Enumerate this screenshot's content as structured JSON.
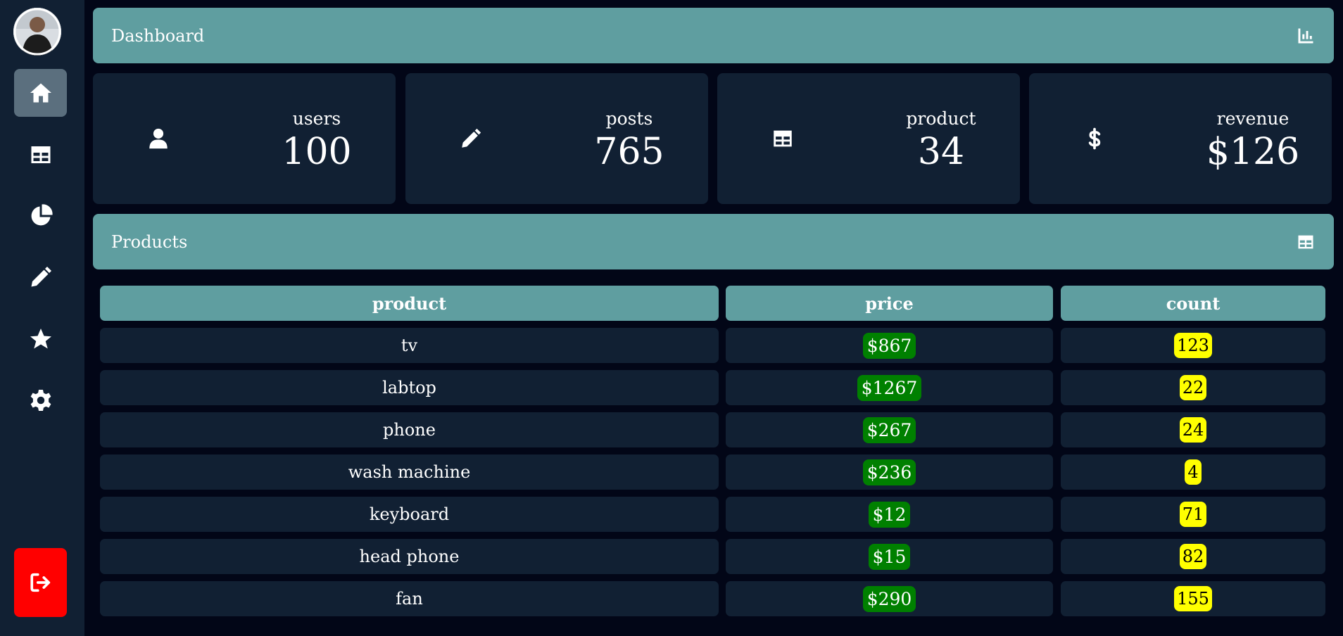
{
  "header": {
    "title": "Dashboard",
    "icon": "chart-bar-icon"
  },
  "sidebar": {
    "items": [
      {
        "name": "home",
        "icon": "home-icon",
        "active": true
      },
      {
        "name": "table",
        "icon": "table-icon",
        "active": false
      },
      {
        "name": "chart",
        "icon": "pie-chart-icon",
        "active": false
      },
      {
        "name": "edit",
        "icon": "pencil-icon",
        "active": false
      },
      {
        "name": "favorites",
        "icon": "star-icon",
        "active": false
      },
      {
        "name": "settings",
        "icon": "gear-icon",
        "active": false
      }
    ],
    "logout_icon": "logout-icon"
  },
  "stats": [
    {
      "label": "users",
      "value": "100",
      "icon": "user-icon"
    },
    {
      "label": "posts",
      "value": "765",
      "icon": "pencil-icon"
    },
    {
      "label": "product",
      "value": "34",
      "icon": "table-icon"
    },
    {
      "label": "revenue",
      "value": "$126",
      "icon": "dollar-icon"
    }
  ],
  "products": {
    "title": "Products",
    "icon": "table-icon",
    "columns": [
      "product",
      "price",
      "count"
    ],
    "rows": [
      {
        "product": "tv",
        "price": "$867",
        "count": "123"
      },
      {
        "product": "labtop",
        "price": "$1267",
        "count": "22"
      },
      {
        "product": "phone",
        "price": "$267",
        "count": "24"
      },
      {
        "product": "wash machine",
        "price": "$236",
        "count": "4"
      },
      {
        "product": "keyboard",
        "price": "$12",
        "count": "71"
      },
      {
        "product": "head phone",
        "price": "$15",
        "count": "82"
      },
      {
        "product": "fan",
        "price": "$290",
        "count": "155"
      }
    ]
  },
  "colors": {
    "background": "#020617",
    "panel": "#112033",
    "accent": "#5f9ea0",
    "active_nav": "#5b6f7e",
    "logout": "#ff0000",
    "price_badge": "#008000",
    "count_badge": "#ffff00"
  }
}
